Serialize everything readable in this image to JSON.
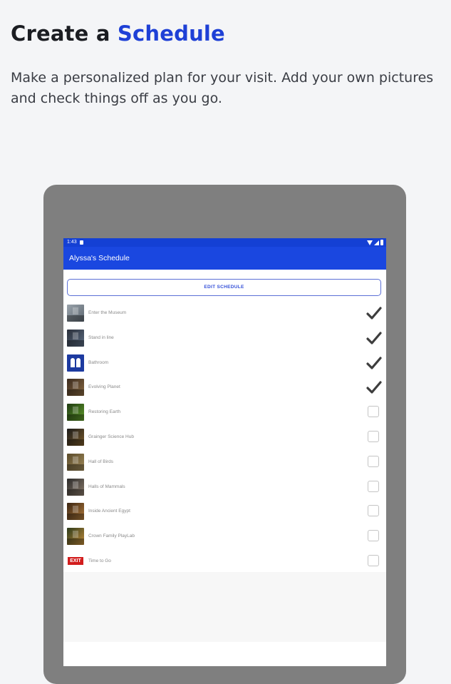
{
  "headline": {
    "prefix": "Create a",
    "accent": "Schedule"
  },
  "subtext": "Make a personalized plan for your visit. Add your own pictures and check things off as you go.",
  "device": {
    "status_time": "1:43",
    "app_title": "Alyssa's Schedule",
    "edit_button": "EDIT SCHEDULE",
    "items": [
      {
        "label": "Enter the Museum",
        "checked": true,
        "thumb": "museum-entrance-photo"
      },
      {
        "label": "Stand in line",
        "checked": true,
        "thumb": "line-photo"
      },
      {
        "label": "Bathroom",
        "checked": true,
        "thumb": "restroom-sign"
      },
      {
        "label": "Evolving Planet",
        "checked": true,
        "thumb": "exhibit-photo"
      },
      {
        "label": "Restoring Earth",
        "checked": false,
        "thumb": "exhibit-photo"
      },
      {
        "label": "Grainger Science Hub",
        "checked": false,
        "thumb": "exhibit-photo"
      },
      {
        "label": "Hall of Birds",
        "checked": false,
        "thumb": "exhibit-photo"
      },
      {
        "label": "Halls of Mammals",
        "checked": false,
        "thumb": "exhibit-photo"
      },
      {
        "label": "Inside Ancient Egypt",
        "checked": false,
        "thumb": "exhibit-photo"
      },
      {
        "label": "Crown Family PlayLab",
        "checked": false,
        "thumb": "exhibit-photo"
      },
      {
        "label": "Time to Go",
        "checked": false,
        "thumb": "exit-sign"
      }
    ],
    "exit_sign_text": "EXIT"
  },
  "colors": {
    "accent": "#1e40d6",
    "appbar": "#1a47e0",
    "check": "#3d3d3d"
  }
}
